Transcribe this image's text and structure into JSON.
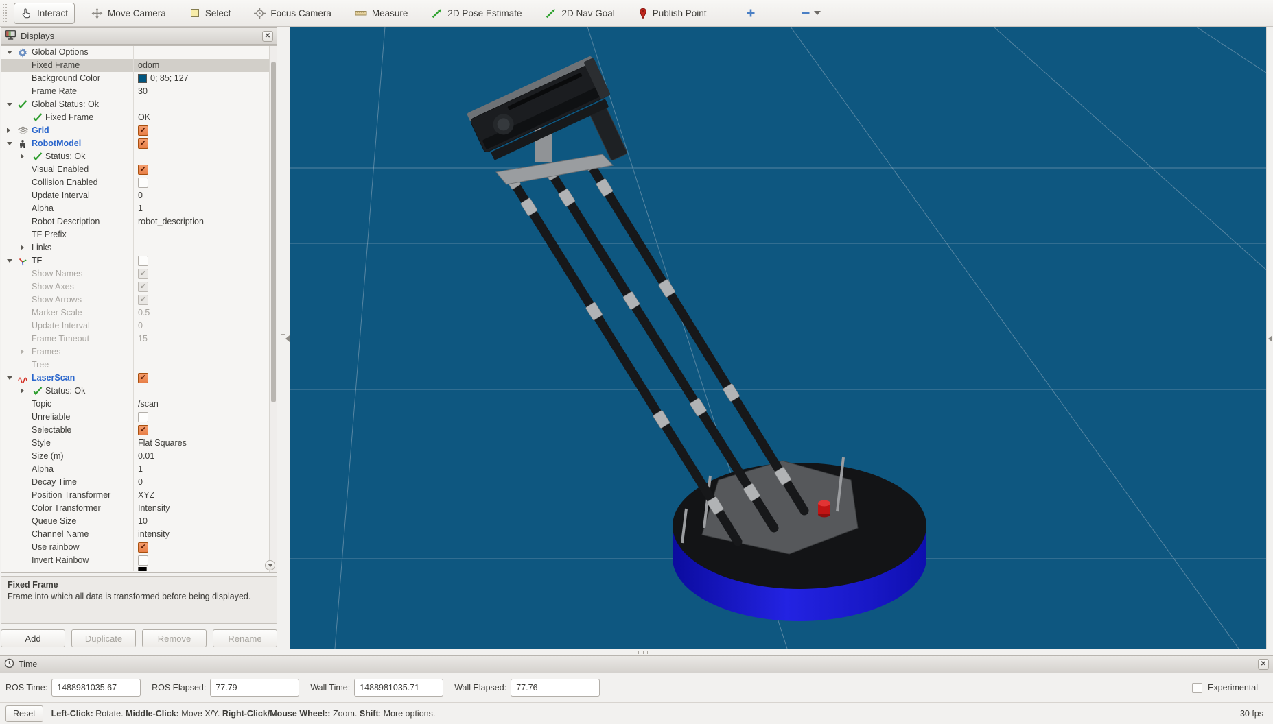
{
  "toolbar": {
    "tools": [
      {
        "label": "Interact",
        "icon": "hand-icon",
        "active": true
      },
      {
        "label": "Move Camera",
        "icon": "move-arrows-icon",
        "active": false
      },
      {
        "label": "Select",
        "icon": "select-box-icon",
        "active": false
      },
      {
        "label": "Focus Camera",
        "icon": "focus-crosshair-icon",
        "active": false
      },
      {
        "label": "Measure",
        "icon": "ruler-icon",
        "active": false
      },
      {
        "label": "2D Pose Estimate",
        "icon": "green-arrow-icon",
        "active": false
      },
      {
        "label": "2D Nav Goal",
        "icon": "green-arrow-icon",
        "active": false
      },
      {
        "label": "Publish Point",
        "icon": "map-pin-icon",
        "active": false
      }
    ]
  },
  "displays": {
    "title": "Displays",
    "tree": {
      "rows": [
        {
          "label": "Global Options",
          "lvl": "top",
          "arrow": "open",
          "icon": "gear-icon"
        },
        {
          "label": "Fixed Frame",
          "lvl": "prop",
          "selected": true,
          "value": {
            "type": "text",
            "text": "odom"
          }
        },
        {
          "label": "Background Color",
          "lvl": "prop",
          "value": {
            "type": "color",
            "swatch": "#00557F",
            "text": "0; 85; 127"
          }
        },
        {
          "label": "Frame Rate",
          "lvl": "prop",
          "value": {
            "type": "text",
            "text": "30"
          }
        },
        {
          "label": "Global Status: Ok",
          "lvl": "top",
          "arrow": "open",
          "icon": "ok-check-icon"
        },
        {
          "label": "Fixed Frame",
          "lvl": "sub",
          "icon": "ok-check-icon",
          "value": {
            "type": "text",
            "text": "OK"
          }
        },
        {
          "label": "Grid",
          "lvl": "top",
          "arrow": "closed",
          "icon": "grid-icon",
          "blue": true,
          "value": {
            "type": "check",
            "state": "on"
          }
        },
        {
          "label": "RobotModel",
          "lvl": "top",
          "arrow": "open",
          "icon": "robot-icon",
          "blue": true,
          "value": {
            "type": "check",
            "state": "on"
          }
        },
        {
          "label": "Status: Ok",
          "lvl": "sub",
          "arrow": "closed",
          "icon": "ok-check-icon"
        },
        {
          "label": "Visual Enabled",
          "lvl": "prop",
          "value": {
            "type": "check",
            "state": "on"
          }
        },
        {
          "label": "Collision Enabled",
          "lvl": "prop",
          "value": {
            "type": "check",
            "state": "off"
          }
        },
        {
          "label": "Update Interval",
          "lvl": "prop",
          "value": {
            "type": "text",
            "text": "0"
          }
        },
        {
          "label": "Alpha",
          "lvl": "prop",
          "value": {
            "type": "text",
            "text": "1"
          }
        },
        {
          "label": "Robot Description",
          "lvl": "prop",
          "value": {
            "type": "text",
            "text": "robot_description"
          }
        },
        {
          "label": "TF Prefix",
          "lvl": "prop"
        },
        {
          "label": "Links",
          "lvl": "group",
          "arrow": "closed"
        },
        {
          "label": "TF",
          "lvl": "top",
          "arrow": "open",
          "icon": "tf-axes-icon",
          "boldDark": true,
          "value": {
            "type": "check",
            "state": "off"
          }
        },
        {
          "label": "Show Names",
          "lvl": "prop",
          "disabled": true,
          "value": {
            "type": "check",
            "state": "dison"
          }
        },
        {
          "label": "Show Axes",
          "lvl": "prop",
          "disabled": true,
          "value": {
            "type": "check",
            "state": "dison"
          }
        },
        {
          "label": "Show Arrows",
          "lvl": "prop",
          "disabled": true,
          "value": {
            "type": "check",
            "state": "dison"
          }
        },
        {
          "label": "Marker Scale",
          "lvl": "prop",
          "disabled": true,
          "value": {
            "type": "text",
            "text": "0.5"
          }
        },
        {
          "label": "Update Interval",
          "lvl": "prop",
          "disabled": true,
          "value": {
            "type": "text",
            "text": "0"
          }
        },
        {
          "label": "Frame Timeout",
          "lvl": "prop",
          "disabled": true,
          "value": {
            "type": "text",
            "text": "15"
          }
        },
        {
          "label": "Frames",
          "lvl": "group",
          "arrow": "closed",
          "disabled": true
        },
        {
          "label": "Tree",
          "lvl": "prop",
          "disabled": true
        },
        {
          "label": "LaserScan",
          "lvl": "top",
          "arrow": "open",
          "icon": "laser-icon",
          "blue": true,
          "value": {
            "type": "check",
            "state": "on"
          }
        },
        {
          "label": "Status: Ok",
          "lvl": "sub",
          "arrow": "closed",
          "icon": "ok-check-icon"
        },
        {
          "label": "Topic",
          "lvl": "prop",
          "value": {
            "type": "text",
            "text": "/scan"
          }
        },
        {
          "label": "Unreliable",
          "lvl": "prop",
          "value": {
            "type": "check",
            "state": "off"
          }
        },
        {
          "label": "Selectable",
          "lvl": "prop",
          "value": {
            "type": "check",
            "state": "on"
          }
        },
        {
          "label": "Style",
          "lvl": "prop",
          "value": {
            "type": "text",
            "text": "Flat Squares"
          }
        },
        {
          "label": "Size (m)",
          "lvl": "prop",
          "value": {
            "type": "text",
            "text": "0.01"
          }
        },
        {
          "label": "Alpha",
          "lvl": "prop",
          "value": {
            "type": "text",
            "text": "1"
          }
        },
        {
          "label": "Decay Time",
          "lvl": "prop",
          "value": {
            "type": "text",
            "text": "0"
          }
        },
        {
          "label": "Position Transformer",
          "lvl": "prop",
          "value": {
            "type": "text",
            "text": "XYZ"
          }
        },
        {
          "label": "Color Transformer",
          "lvl": "prop",
          "value": {
            "type": "text",
            "text": "Intensity"
          }
        },
        {
          "label": "Queue Size",
          "lvl": "prop",
          "value": {
            "type": "text",
            "text": "10"
          }
        },
        {
          "label": "Channel Name",
          "lvl": "prop",
          "value": {
            "type": "text",
            "text": "intensity"
          }
        },
        {
          "label": "Use rainbow",
          "lvl": "prop",
          "value": {
            "type": "check",
            "state": "on"
          }
        },
        {
          "label": "Invert Rainbow",
          "lvl": "prop",
          "value": {
            "type": "check",
            "state": "off"
          }
        },
        {
          "label": "",
          "lvl": "prop",
          "partial": true,
          "value": {
            "type": "color",
            "swatch": "#000000",
            "text": ""
          }
        }
      ]
    },
    "help": {
      "title": "Fixed Frame",
      "body": "Frame into which all data is transformed before being displayed."
    },
    "buttons": [
      {
        "label": "Add",
        "enabled": true
      },
      {
        "label": "Duplicate",
        "enabled": false
      },
      {
        "label": "Remove",
        "enabled": false
      },
      {
        "label": "Rename",
        "enabled": false
      }
    ]
  },
  "scene": {
    "background_hex": "#0E5780",
    "background_rgb": "0; 85; 127",
    "grid_line_color": "#9EB4C4",
    "robot_base_color": "#2323E2",
    "robot_button_color": "#C01414"
  },
  "time": {
    "title": "Time",
    "fields": [
      {
        "label": "ROS Time:",
        "value": "1488981035.67"
      },
      {
        "label": "ROS Elapsed:",
        "value": "77.79"
      },
      {
        "label": "Wall Time:",
        "value": "1488981035.71"
      },
      {
        "label": "Wall Elapsed:",
        "value": "77.76"
      }
    ],
    "experimental_label": "Experimental",
    "experimental_checked": false
  },
  "status": {
    "reset_label": "Reset",
    "help_segments": [
      {
        "text": "Left-Click:",
        "bold": true
      },
      {
        "text": " Rotate. ",
        "bold": false
      },
      {
        "text": "Middle-Click:",
        "bold": true
      },
      {
        "text": " Move X/Y. ",
        "bold": false
      },
      {
        "text": "Right-Click/Mouse Wheel::",
        "bold": true
      },
      {
        "text": " Zoom. ",
        "bold": false
      },
      {
        "text": "Shift",
        "bold": true
      },
      {
        "text": ": More options.",
        "bold": false
      }
    ],
    "fps": "30 fps"
  }
}
